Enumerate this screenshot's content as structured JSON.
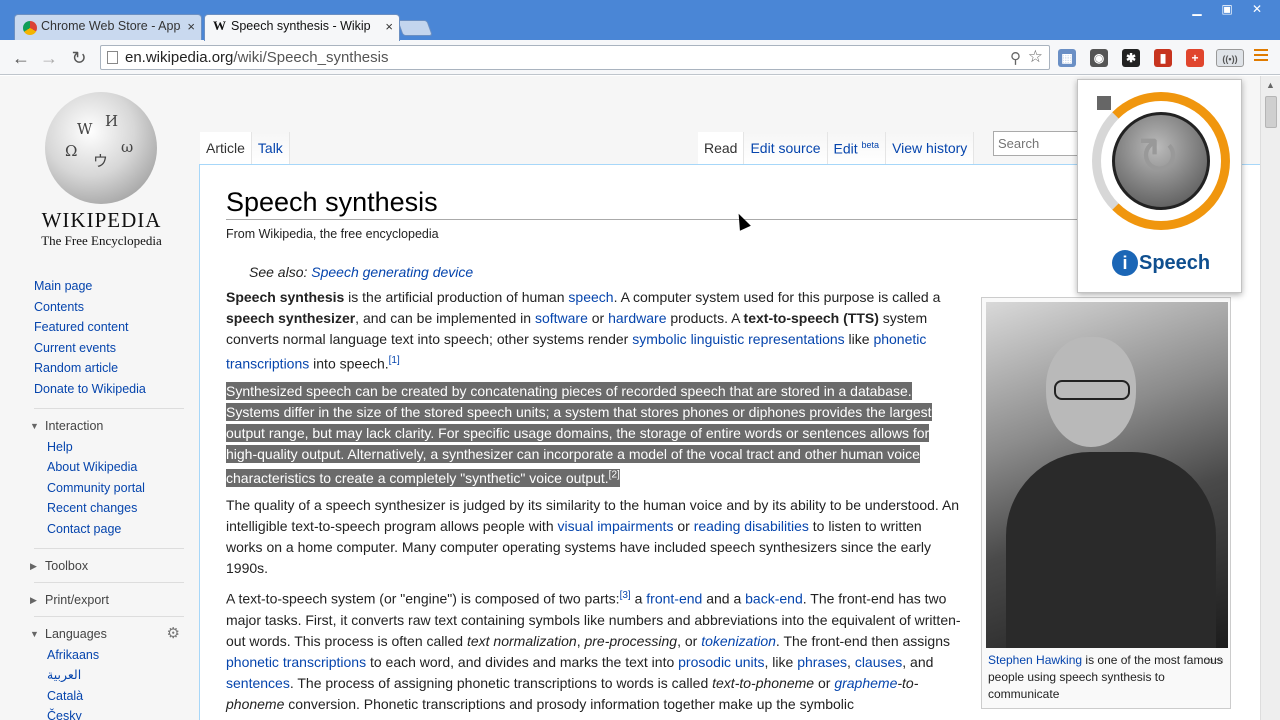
{
  "browser": {
    "tabs": [
      {
        "title": "Chrome Web Store - Apps",
        "active": false,
        "close": "×"
      },
      {
        "title": "Speech synthesis - Wikipedia",
        "active": true,
        "close": "×"
      }
    ],
    "window_controls": {
      "minimize": "▁",
      "maximize": "▣",
      "close": "✕"
    },
    "url_host": "en.wikipedia.org",
    "url_path": "/wiki/Speech_synthesis",
    "icons": [
      "back-icon",
      "forward-icon",
      "reload-icon",
      "zoom-icon",
      "star-icon"
    ],
    "extensions": [
      {
        "name": "extension-icon-1",
        "glyph": "▦",
        "color": "#6a8fc5"
      },
      {
        "name": "extension-icon-2",
        "glyph": "◉",
        "color": "#555555"
      },
      {
        "name": "extension-icon-3",
        "glyph": "✱",
        "color": "#222222"
      },
      {
        "name": "extension-icon-4",
        "glyph": "▮",
        "color": "#c7341f"
      },
      {
        "name": "extension-icon-5",
        "glyph": "+",
        "color": "#e0452d"
      },
      {
        "name": "ispeech-extension-icon",
        "glyph": "((•))",
        "color": "#777777"
      }
    ]
  },
  "wiki": {
    "wordmark": "Wikipedia",
    "tagline": "The Free Encyclopedia",
    "nav": [
      "Main page",
      "Contents",
      "Featured content",
      "Current events",
      "Random article",
      "Donate to Wikipedia"
    ],
    "interaction": {
      "heading": "Interaction",
      "items": [
        "Help",
        "About Wikipedia",
        "Community portal",
        "Recent changes",
        "Contact page"
      ]
    },
    "toolbox": "Toolbox",
    "print_export": "Print/export",
    "languages": {
      "heading": "Languages",
      "items": [
        "Afrikaans",
        "العربية",
        "Català",
        "Česky"
      ]
    },
    "tabs_left": [
      "Article",
      "Talk"
    ],
    "tabs_right": {
      "read": "Read",
      "edit_source": "Edit source",
      "edit": "Edit",
      "edit_sup": "beta",
      "history": "View history"
    },
    "search_placeholder": "Search",
    "title": "Speech synthesis",
    "sitesub": "From Wikipedia, the free encyclopedia",
    "see_also_label": "See also: ",
    "see_also_link": "Speech generating device",
    "image_caption_link": "Stephen Hawking",
    "image_caption_rest": " is one of the most famous people using speech synthesis to communicate"
  },
  "ispeech": {
    "brand_i": "i",
    "brand_rest": "Speech"
  },
  "colors": {
    "link": "#0645ad",
    "tabstrip": "#4a86d6",
    "ispeech_orange": "#f0960e",
    "highlight": "#6b6b6b"
  }
}
